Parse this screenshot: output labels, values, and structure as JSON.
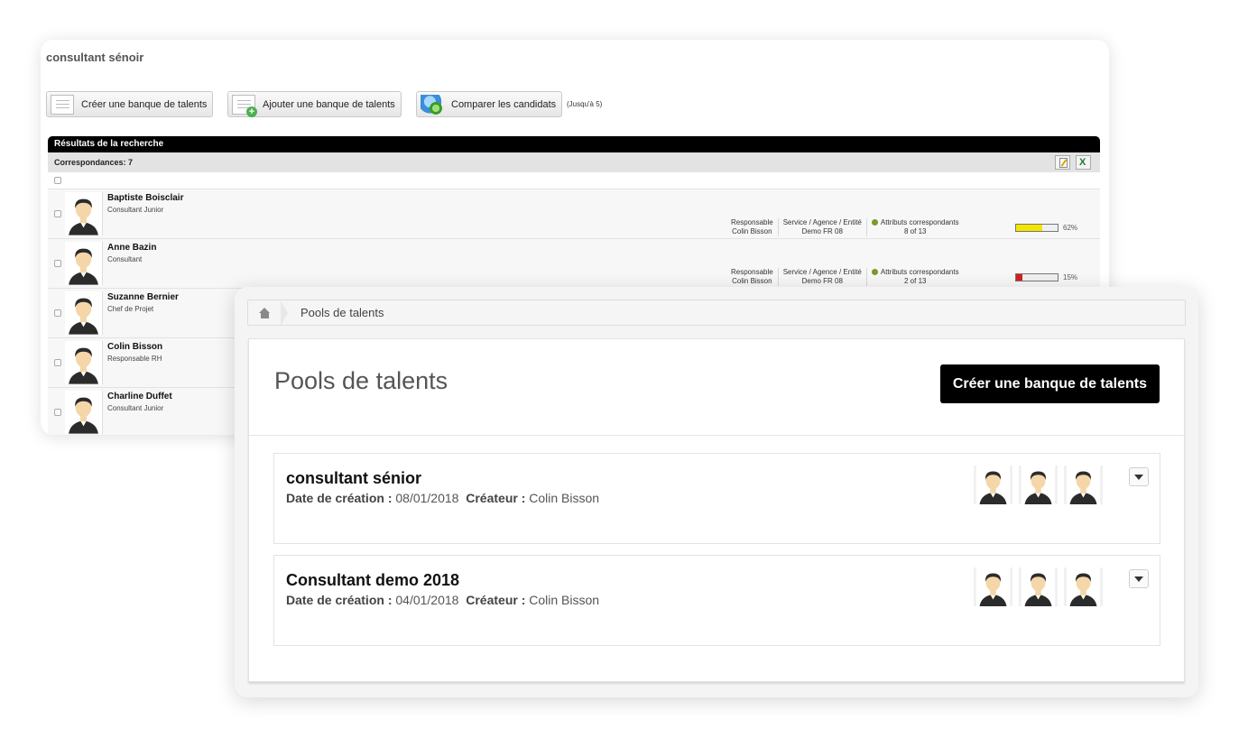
{
  "back_window": {
    "title": "consultant sénoir",
    "toolbar": {
      "create_label": "Créer une banque de talents",
      "add_label": "Ajouter une banque de talents",
      "compare_label": "Comparer les candidats",
      "compare_note": "(Jusqu'à 5)"
    },
    "results": {
      "header": "Résultats de la recherche",
      "matches": "Correspondances: 7",
      "meta_labels": {
        "manager": "Responsable",
        "service": "Service / Agence / Entité",
        "attributes": "Attributs correspondants"
      },
      "rows": [
        {
          "name": "Baptiste Boisclair",
          "title": "Consultant Junior",
          "manager": "Colin Bisson",
          "service": "Demo FR 08",
          "attributes": "8 of 13",
          "pct": "62%",
          "bar_fill": 0.62,
          "bar_color": "#f3e500"
        },
        {
          "name": "Anne Bazin",
          "title": "Consultant",
          "manager": "Colin Bisson",
          "service": "Demo FR 08",
          "attributes": "2 of 13",
          "pct": "15%",
          "bar_fill": 0.15,
          "bar_color": "#d42020"
        },
        {
          "name": "Suzanne Bernier",
          "title": "Chef de Projet"
        },
        {
          "name": "Colin Bisson",
          "title": "Responsable RH"
        },
        {
          "name": "Charline Duffet",
          "title": "Consultant Junior"
        }
      ]
    }
  },
  "front_window": {
    "breadcrumb": {
      "current": "Pools de talents",
      "home_icon": "home-icon"
    },
    "title": "Pools de talents",
    "create_button": "Créer une banque de talents",
    "labels": {
      "created": "Date de création :",
      "creator": "Créateur :"
    },
    "pools": [
      {
        "name": "consultant sénior",
        "date": "08/01/2018",
        "creator": "Colin Bisson",
        "avatars": 3
      },
      {
        "name": "Consultant demo 2018",
        "date": "04/01/2018",
        "creator": "Colin Bisson",
        "avatars": 3
      }
    ]
  },
  "colors": {
    "accent": "#000000",
    "progress_high": "#f3e500",
    "progress_low": "#d42020"
  }
}
